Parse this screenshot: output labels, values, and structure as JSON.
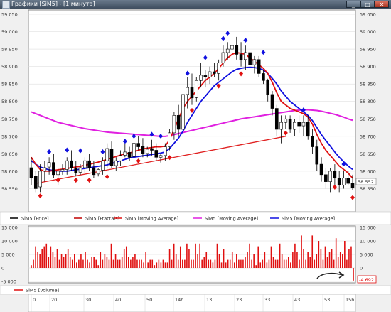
{
  "window": {
    "title": "Графики [SiM5] - [1 минута]",
    "buttons": {
      "minimize": "_",
      "restore": "□",
      "close": "✕"
    }
  },
  "colors": {
    "price": "#000000",
    "fractals": "#c00000",
    "ma_fast": "#e01010",
    "ma_slow": "#e020e0",
    "ma_mid": "#1010e0",
    "volume": "#e01010",
    "trendline": "#e02020"
  },
  "price_panel": {
    "y_ticks": [
      "59 050",
      "59 000",
      "58 950",
      "58 900",
      "58 850",
      "58 800",
      "58 750",
      "58 700",
      "58 650",
      "58 600",
      "58 550"
    ],
    "right_extra_label": "58 552",
    "legend": [
      {
        "label": "SiM5 [Price]",
        "color": "#000000",
        "icon": "line"
      },
      {
        "label": "SiM5 [Fractals]",
        "color": "#c00000",
        "icon": "line"
      },
      {
        "label": "SiM5 [Moving Average]",
        "color": "#e01010",
        "icon": "line"
      },
      {
        "label": "SiM5 [Moving Average]",
        "color": "#e020e0",
        "icon": "line"
      },
      {
        "label": "SiM5 [Moving Average]",
        "color": "#1010e0",
        "icon": "line"
      }
    ]
  },
  "volume_panel": {
    "y_ticks_left": [
      "15 000",
      "10 000",
      "5 000",
      "0",
      "-5 000"
    ],
    "y_ticks_right": [
      "15 000",
      "10 000",
      "5 000",
      "0"
    ],
    "current_value_badge": "-4 692",
    "legend": [
      {
        "label": "SiM5 [Volume]",
        "color": "#e01010",
        "icon": "line"
      }
    ],
    "bars": [
      1,
      3,
      8,
      6,
      5,
      7,
      8,
      9,
      4,
      8,
      6,
      4,
      7,
      3,
      5,
      4,
      5,
      7,
      4,
      3,
      5,
      2,
      3,
      5,
      3,
      6,
      3,
      2,
      4,
      4,
      3,
      1,
      6,
      3,
      5,
      4,
      3,
      9,
      3,
      5,
      3,
      3,
      4,
      7,
      8,
      4,
      3,
      4,
      5,
      3,
      3,
      3,
      2,
      6,
      2,
      3,
      3,
      1,
      2,
      3,
      2,
      3,
      2,
      2,
      7,
      3,
      9,
      5,
      3,
      8,
      3,
      3,
      9,
      7,
      3,
      3,
      9,
      5,
      9,
      3,
      4,
      6,
      3,
      3,
      2,
      3,
      9,
      5,
      2,
      7,
      2,
      3,
      3,
      6,
      2,
      5,
      3,
      3,
      3,
      4,
      6,
      9,
      3,
      5,
      1,
      8,
      2,
      3,
      6,
      2,
      3,
      8,
      4,
      3,
      3,
      9,
      5,
      3,
      3,
      4,
      2,
      6,
      9,
      6,
      3,
      12,
      7,
      3,
      6,
      4,
      12,
      3,
      5,
      10,
      7,
      3,
      8,
      4,
      6,
      7,
      3,
      11,
      4,
      6,
      5,
      10,
      3,
      7,
      8,
      -4.7
    ]
  },
  "time_axis": [
    "0",
    "20",
    "30",
    "40",
    "50",
    "14h",
    "13",
    "23",
    "33",
    "43",
    "53",
    "15h"
  ],
  "chart_data": {
    "type": "candlestick",
    "ylim": [
      58500,
      59050
    ],
    "candles": [
      [
        58610,
        58640,
        58560,
        58580
      ],
      [
        58585,
        58600,
        58540,
        58550
      ],
      [
        58555,
        58620,
        58540,
        58600
      ],
      [
        58600,
        58630,
        58570,
        58610
      ],
      [
        58612,
        58640,
        58590,
        58625
      ],
      [
        58625,
        58650,
        58580,
        58590
      ],
      [
        58590,
        58610,
        58560,
        58600
      ],
      [
        58600,
        58620,
        58590,
        58605
      ],
      [
        58605,
        58640,
        58590,
        58630
      ],
      [
        58630,
        58660,
        58600,
        58610
      ],
      [
        58608,
        58630,
        58585,
        58595
      ],
      [
        58597,
        58620,
        58590,
        58610
      ],
      [
        58610,
        58640,
        58595,
        58630
      ],
      [
        58630,
        58650,
        58600,
        58610
      ],
      [
        58610,
        58630,
        58580,
        58590
      ],
      [
        58592,
        58610,
        58585,
        58605
      ],
      [
        58603,
        58640,
        58590,
        58630
      ],
      [
        58630,
        58680,
        58610,
        58665
      ],
      [
        58664,
        58685,
        58610,
        58615
      ],
      [
        58616,
        58640,
        58600,
        58630
      ],
      [
        58630,
        58660,
        58615,
        58645
      ],
      [
        58646,
        58680,
        58640,
        58655
      ],
      [
        58654,
        58670,
        58630,
        58640
      ],
      [
        58642,
        58690,
        58635,
        58680
      ],
      [
        58680,
        58700,
        58660,
        58670
      ],
      [
        58671,
        58695,
        58640,
        58650
      ],
      [
        58651,
        58670,
        58640,
        58663
      ],
      [
        58665,
        58690,
        58645,
        58660
      ],
      [
        58660,
        58680,
        58630,
        58640
      ],
      [
        58640,
        58650,
        58625,
        58645
      ],
      [
        58645,
        58680,
        58630,
        58670
      ],
      [
        58670,
        58720,
        58660,
        58710
      ],
      [
        58710,
        58770,
        58690,
        58760
      ],
      [
        58760,
        58790,
        58700,
        58720
      ],
      [
        58720,
        58830,
        58710,
        58820
      ],
      [
        58820,
        58870,
        58780,
        58840
      ],
      [
        58840,
        58880,
        58790,
        58810
      ],
      [
        58811,
        58870,
        58800,
        58860
      ],
      [
        58860,
        58910,
        58840,
        58875
      ],
      [
        58874,
        58890,
        58840,
        58870
      ],
      [
        58870,
        58900,
        58850,
        58885
      ],
      [
        58885,
        58910,
        58870,
        58880
      ],
      [
        58880,
        58920,
        58860,
        58910
      ],
      [
        58910,
        58960,
        58900,
        58940
      ],
      [
        58940,
        58970,
        58920,
        58950
      ],
      [
        58950,
        58990,
        58930,
        58960
      ],
      [
        58961,
        58985,
        58920,
        58935
      ],
      [
        58935,
        58970,
        58900,
        58920
      ],
      [
        58920,
        58960,
        58890,
        58940
      ],
      [
        58940,
        58950,
        58895,
        58905
      ],
      [
        58905,
        58930,
        58880,
        58920
      ],
      [
        58920,
        58930,
        58870,
        58880
      ],
      [
        58880,
        58890,
        58850,
        58860
      ],
      [
        58860,
        58865,
        58800,
        58820
      ],
      [
        58820,
        58830,
        58760,
        58780
      ],
      [
        58780,
        58790,
        58700,
        58720
      ],
      [
        58720,
        58760,
        58680,
        58740
      ],
      [
        58740,
        58760,
        58720,
        58750
      ],
      [
        58750,
        58760,
        58710,
        58720
      ],
      [
        58720,
        58750,
        58700,
        58740
      ],
      [
        58740,
        58760,
        58710,
        58730
      ],
      [
        58730,
        58760,
        58700,
        58740
      ],
      [
        58740,
        58760,
        58690,
        58700
      ],
      [
        58700,
        58720,
        58650,
        58670
      ],
      [
        58670,
        58690,
        58600,
        58620
      ],
      [
        58620,
        58640,
        58570,
        58590
      ],
      [
        58590,
        58610,
        58550,
        58570
      ],
      [
        58570,
        58610,
        58540,
        58600
      ],
      [
        58600,
        58620,
        58560,
        58580
      ],
      [
        58580,
        58600,
        58540,
        58560
      ],
      [
        58560,
        58600,
        58550,
        58580
      ],
      [
        58580,
        58600,
        58560,
        58565
      ],
      [
        58566,
        58590,
        58545,
        58552
      ]
    ],
    "ma_fast": [
      58640,
      58620,
      58605,
      58600,
      58600,
      58602,
      58604,
      58606,
      58608,
      58610,
      58612,
      58614,
      58617,
      58620,
      58623,
      58626,
      58630,
      58634,
      58638,
      58642,
      58646,
      58650,
      58652,
      58656,
      58660,
      58664,
      58666,
      58668,
      58670,
      58670,
      58672,
      58690,
      58720,
      58750,
      58780,
      58800,
      58815,
      58830,
      58845,
      58860,
      58870,
      58880,
      58895,
      58910,
      58925,
      58935,
      58940,
      58938,
      58935,
      58925,
      58915,
      58905,
      58895,
      58880,
      58855,
      58825,
      58800,
      58790,
      58780,
      58775,
      58770,
      58765,
      58755,
      58735,
      58705,
      58680,
      58660,
      58645,
      58630,
      58615,
      58605,
      58595,
      58580
    ],
    "ma_mid": [
      58630,
      58620,
      58612,
      58608,
      58604,
      58602,
      58600,
      58600,
      58600,
      58602,
      58604,
      58606,
      58608,
      58610,
      58612,
      58614,
      58616,
      58618,
      58622,
      58626,
      58630,
      58634,
      58638,
      58640,
      58642,
      58644,
      58646,
      58648,
      58650,
      58652,
      58655,
      58665,
      58680,
      58695,
      58715,
      58740,
      58760,
      58780,
      58800,
      58815,
      58830,
      58845,
      58855,
      58865,
      58875,
      58885,
      58892,
      58895,
      58897,
      58898,
      58897,
      58895,
      58890,
      58880,
      58866,
      58850,
      58830,
      58815,
      58800,
      58790,
      58780,
      58770,
      58760,
      58745,
      58725,
      58705,
      58688,
      58672,
      58655,
      58640,
      58627,
      58615,
      58605
    ],
    "ma_slow": [
      58770,
      58765,
      58760,
      58755,
      58750,
      58745,
      58740,
      58737,
      58734,
      58731,
      58728,
      58725,
      58722,
      58720,
      58718,
      58716,
      58714,
      58712,
      58711,
      58710,
      58709,
      58708,
      58707,
      58706,
      58705,
      58704,
      58703,
      58702,
      58701,
      58700,
      58700,
      58702,
      58705,
      58708,
      58711,
      58714,
      58717,
      58720,
      58723,
      58726,
      58729,
      58732,
      58735,
      58738,
      58741,
      58744,
      58747,
      58750,
      58752,
      58754,
      58756,
      58758,
      58760,
      58762,
      58764,
      58766,
      58768,
      58770,
      58772,
      58774,
      58775,
      58776,
      58776,
      58775,
      58774,
      58772,
      58769,
      58766,
      58763,
      58759,
      58755,
      58750,
      58746
    ],
    "fractals_up": [
      [
        4,
        58655
      ],
      [
        8,
        58660
      ],
      [
        11,
        58658
      ],
      [
        16,
        58655
      ],
      [
        21,
        58685
      ],
      [
        23,
        58700
      ],
      [
        27,
        58705
      ],
      [
        29,
        58700
      ],
      [
        35,
        58880
      ],
      [
        39,
        58925
      ],
      [
        43,
        58980
      ],
      [
        44,
        58995
      ],
      [
        48,
        58975
      ],
      [
        52,
        58940
      ],
      [
        61,
        58775
      ],
      [
        70,
        58620
      ]
    ],
    "fractals_down": [
      [
        2,
        58530
      ],
      [
        6,
        58575
      ],
      [
        10,
        58575
      ],
      [
        13,
        58575
      ],
      [
        17,
        58585
      ],
      [
        24,
        58630
      ],
      [
        31,
        58640
      ],
      [
        36,
        58775
      ],
      [
        42,
        58845
      ],
      [
        47,
        58880
      ],
      [
        57,
        58710
      ],
      [
        68,
        58555
      ],
      [
        72,
        58525
      ]
    ],
    "trendline": [
      [
        1,
        58565
      ],
      [
        57,
        58700
      ]
    ]
  }
}
